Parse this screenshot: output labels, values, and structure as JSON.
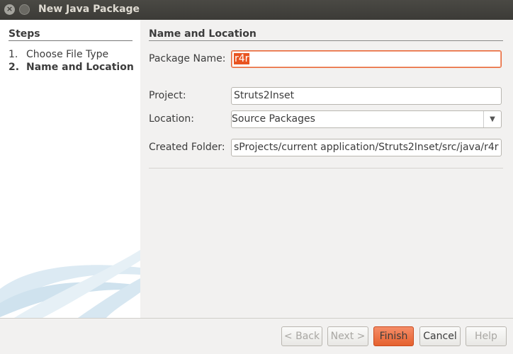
{
  "window": {
    "title": "New Java Package"
  },
  "steps": {
    "title": "Steps",
    "items": [
      {
        "num": "1.",
        "label": "Choose File Type"
      },
      {
        "num": "2.",
        "label": "Name and Location"
      }
    ]
  },
  "content": {
    "section_title": "Name and Location",
    "package_name": {
      "label": "Package Name:",
      "value": "r4r"
    },
    "project": {
      "label": "Project:",
      "value": "Struts2Inset"
    },
    "location": {
      "label": "Location:",
      "value": "Source Packages"
    },
    "created_folder": {
      "label": "Created Folder:",
      "value": "sProjects/current application/Struts2Inset/src/java/r4r"
    }
  },
  "buttons": {
    "back": "< Back",
    "next": "Next >",
    "finish": "Finish",
    "cancel": "Cancel",
    "help": "Help"
  },
  "colors": {
    "accent": "#e95420",
    "titlebar": "#3c3b37"
  }
}
